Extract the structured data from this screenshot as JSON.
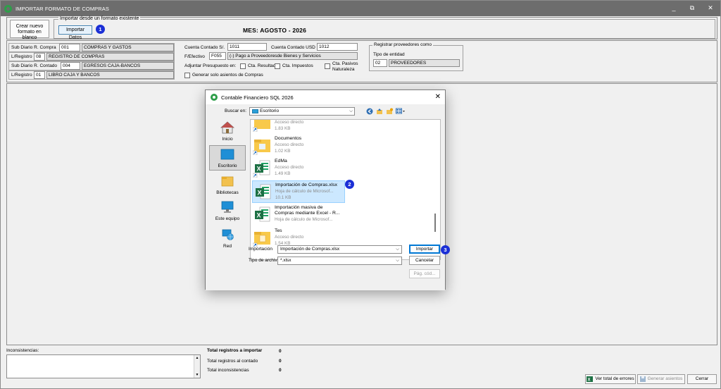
{
  "window": {
    "title": "IMPORTAR FORMATO DE COMPRAS",
    "controls": [
      "_",
      "⧉",
      "✕"
    ]
  },
  "top": {
    "new_button": "Crear nuevo formato en blanco",
    "group_legend": "Importar desde un formato existente",
    "import_button": "Importar Datos",
    "badge1": "1",
    "mes_label": "MES: AGOSTO - 2026"
  },
  "config": {
    "subdiario_compra_label": "Sub Diario R. Compra",
    "subdiario_compra_code": "001",
    "subdiario_compra_name": "COMPRAS Y GASTOS",
    "lregistro1_label": "L/Registro",
    "lregistro1_code": "08",
    "lregistro1_name": "REGISTRO DE COMPRAS",
    "subdiario_contado_label": "Sub Diario R. Contado",
    "subdiario_contado_code": "004",
    "subdiario_contado_name": "EGRESOS CAJA-BANCOS",
    "lregistro2_label": "L/Registro",
    "lregistro2_code": "01",
    "lregistro2_name": "LIBRO CAJA Y BANCOS",
    "cuenta_soles_label": "Cuenta Contado S/.",
    "cuenta_soles_value": "1011",
    "cuenta_usd_label": "Cuenta Contado USD",
    "cuenta_usd_value": "1012",
    "fefectivo_label": "F/Efectivo",
    "fefectivo_code": "F055",
    "fefectivo_name": "(-) Pago a Proveedoresde Bienes y Servicios",
    "adjuntar_label": "Adjuntar Presupuesto en:",
    "cta_resultados": "Cta. Resultados",
    "cta_impuestos": "Cta. Impuestos",
    "cta_pasivos_1": "Cta. Pasivos",
    "cta_pasivos_2": "Naturaleza",
    "generar_solo": "Generar solo asientos de Compras",
    "registrar_legend": "Registrar proveedores como",
    "tipo_entidad_label": "Tipo de entidad",
    "tipo_entidad_code": "02",
    "tipo_entidad_name": "PROVEEDORES"
  },
  "bottom": {
    "inconsistencias_label": "Inconsistencias:",
    "total_importar_label": "Total registros a importar",
    "total_importar_value": "0",
    "total_contado_label": "Total registros al contado",
    "total_contado_value": "0",
    "total_incons_label": "Total inconsistencias",
    "total_incons_value": "0",
    "btn_errores": "Ver total de errores",
    "btn_generar": "Generar asientos",
    "btn_cerrar": "Cerrar"
  },
  "dialog": {
    "title": "Contable Financiero SQL 2026",
    "close": "✕",
    "buscar_label": "Buscar en:",
    "buscar_value": "Escritorio",
    "places": [
      {
        "label": "Inicio"
      },
      {
        "label": "Escritorio"
      },
      {
        "label": "Bibliotecas"
      },
      {
        "label": "Este equipo"
      },
      {
        "label": "Red"
      }
    ],
    "files": [
      {
        "name": "",
        "type": "Acceso directo",
        "size": "1.83 KB"
      },
      {
        "name": "Documentos",
        "type": "Acceso directo",
        "size": "1.02 KB"
      },
      {
        "name": "EdMa",
        "type": "Acceso directo",
        "size": "1.49 KB"
      },
      {
        "name": "Importación de Compras.xlsx",
        "type": "Hoja de cálculo de Microsof...",
        "size": "10.1 KB"
      },
      {
        "name": "Importación masiva de",
        "name2": "Compras mediante Excel - R...",
        "type": "Hoja de cálculo de Microsof..."
      },
      {
        "name": "Tes",
        "type": "Acceso directo",
        "size": "1.54 KB"
      }
    ],
    "badge2": "2",
    "importacion_label": "Importación",
    "importacion_value": "Importación de Compras.xlsx",
    "tipo_label": "Tipo de archiv",
    "tipo_value": "*.xlsx",
    "btn_importar": "Importar",
    "badge3": "3",
    "btn_cancelar": "Cancelar",
    "btn_pag": "Pág. cód..."
  },
  "colors": {
    "titlebar": "#6d6d6d",
    "badge": "#1b2fd6",
    "selection": "#cce8ff",
    "excel_green": "#1d7044",
    "folder_yellow": "#f8c94a"
  }
}
